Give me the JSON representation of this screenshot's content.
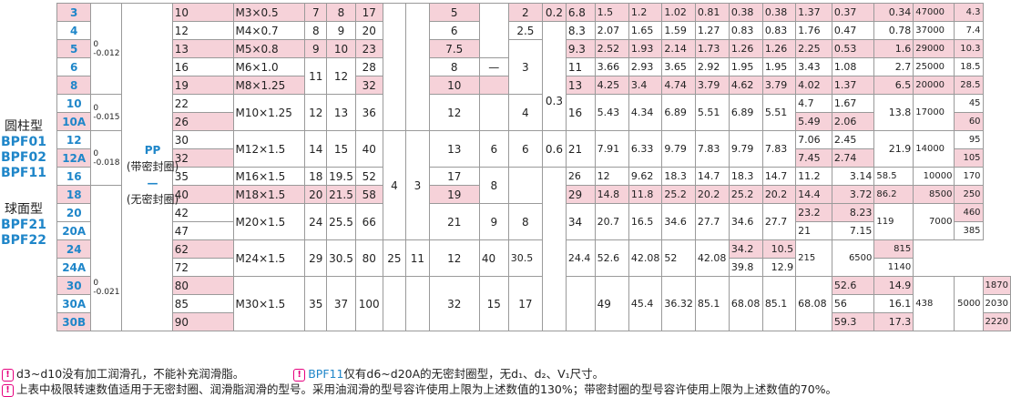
{
  "side_groups": [
    {
      "label": "圆柱型",
      "codes": [
        "BPF01",
        "BPF02",
        "BPF11"
      ]
    },
    {
      "label": "球面型",
      "codes": [
        "BPF21",
        "BPF22"
      ]
    }
  ],
  "tolerances": {
    "t1": {
      "upper": "0",
      "lower": "-0.012"
    },
    "t2": {
      "upper": "0",
      "lower": "-0.015"
    },
    "t3": {
      "upper": "0",
      "lower": "-0.018"
    },
    "t4": {
      "upper": "0",
      "lower": "-0.021"
    }
  },
  "seal": {
    "pp": "PP",
    "pp_note": "(带密封圈)",
    "dash": "—",
    "dash_note": "(无密封圈)"
  },
  "rows": [
    {
      "type": "3",
      "L": "10",
      "M": "M3×0.5",
      "a": "7",
      "b": "8",
      "c": "17",
      "h": "5",
      "j": "2",
      "k": "0.2",
      "d1": "6.8",
      "v1": "1.5",
      "v2": "1.2",
      "v3": "1.02",
      "v4": "0.81",
      "v5": "0.38",
      "v6": "0.38",
      "w1": "1.37",
      "w2": "0.37",
      "w3": "0.34",
      "rpm": "47000",
      "mass": "4.3"
    },
    {
      "type": "4",
      "L": "12",
      "M": "M4×0.7",
      "a": "8",
      "b": "9",
      "c": "20",
      "h": "6",
      "j": "2.5",
      "d1": "8.3",
      "v1": "2.07",
      "v2": "1.65",
      "v3": "1.59",
      "v4": "1.27",
      "v5": "0.83",
      "v6": "0.83",
      "w1": "1.76",
      "w2": "0.47",
      "w3": "0.78",
      "rpm": "37000",
      "mass": "7.4"
    },
    {
      "type": "5",
      "L": "13",
      "M": "M5×0.8",
      "a": "9",
      "b": "10",
      "c": "23",
      "h": "7.5",
      "j": "3",
      "d1": "9.3",
      "v1": "2.52",
      "v2": "1.93",
      "v3": "2.14",
      "v4": "1.73",
      "v5": "1.26",
      "v6": "1.26",
      "w1": "2.25",
      "w2": "0.53",
      "w3": "1.6",
      "rpm": "29000",
      "mass": "10.3"
    },
    {
      "type": "6",
      "L": "16",
      "M": "M6×1.0",
      "ab": "11",
      "bb": "12",
      "c": "28",
      "dash": "—",
      "h": "8",
      "d1": "11",
      "v1": "3.66",
      "v2": "2.93",
      "v3": "3.65",
      "v4": "2.92",
      "v5": "1.95",
      "v6": "1.95",
      "w1": "3.43",
      "w2": "1.08",
      "w3": "2.7",
      "rpm": "25000",
      "mass": "18.5"
    },
    {
      "type": "8",
      "L": "19",
      "M": "M8×1.25",
      "c": "32",
      "h": "10",
      "k": "0.3",
      "d1": "13",
      "v1": "4.25",
      "v2": "3.4",
      "v3": "4.74",
      "v4": "3.79",
      "v5": "4.62",
      "v6": "3.79",
      "w1": "4.02",
      "w2": "1.37",
      "w3": "6.5",
      "rpm": "20000",
      "mass": "28.5"
    },
    {
      "type": "10",
      "L": "22",
      "M": "M10×1.25",
      "a": "12",
      "b": "13",
      "c": "36",
      "h": "12",
      "j": "4",
      "d1": "16",
      "v1": "5.43",
      "v2": "4.34",
      "v3": "6.89",
      "v4": "5.51",
      "v5": "6.89",
      "v6": "5.51",
      "w1": "4.7",
      "w2": "1.67",
      "w3": "13.8",
      "rpm": "17000",
      "mass": "45"
    },
    {
      "type": "10A",
      "L": "26",
      "w1": "5.49",
      "w2": "2.06",
      "mass": "60"
    },
    {
      "type": "12",
      "L": "30",
      "M": "M12×1.5",
      "a": "14",
      "b": "15",
      "c": "40",
      "g": "4",
      "g2": "3",
      "h": "13",
      "i": "6",
      "j": "6",
      "k": "0.6",
      "d1": "21",
      "v1": "7.91",
      "v2": "6.33",
      "v3": "9.79",
      "v4": "7.83",
      "v5": "9.79",
      "v6": "7.83",
      "w1": "7.06",
      "w2": "2.45",
      "w3": "21.9",
      "rpm": "14000",
      "mass": "95"
    },
    {
      "type": "12A",
      "L": "32",
      "w1": "7.45",
      "w2": "2.74",
      "mass": "105"
    },
    {
      "type": "16",
      "L": "35",
      "M": "M16×1.5",
      "a": "18",
      "b": "19.5",
      "c": "52",
      "h": "17",
      "i": "8",
      "d1": "26",
      "v1": "12",
      "v2": "9.62",
      "v3": "18.3",
      "v4": "14.7",
      "v5": "18.3",
      "v6": "14.7",
      "w1": "11.2",
      "w2": "3.14",
      "w3": "58.5",
      "rpm": "10000",
      "mass": "170"
    },
    {
      "type": "18",
      "L": "40",
      "M": "M18×1.5",
      "a": "20",
      "b": "21.5",
      "c": "58",
      "h": "19",
      "d1": "29",
      "v1": "14.8",
      "v2": "11.8",
      "v3": "25.2",
      "v4": "20.2",
      "v5": "25.2",
      "v6": "20.2",
      "w1": "14.4",
      "w2": "3.72",
      "w3": "86.2",
      "rpm": "8500",
      "mass": "250"
    },
    {
      "type": "20",
      "L": "42",
      "M": "M20×1.5",
      "a": "24",
      "b": "25.5",
      "c": "66",
      "h": "21",
      "i": "9",
      "j": "8",
      "d1": "34",
      "v1": "20.7",
      "v2": "16.5",
      "v3": "34.6",
      "v4": "27.7",
      "v5": "34.6",
      "v6": "27.7",
      "w1": "23.2",
      "w2": "8.23",
      "w3": "119",
      "rpm": "7000",
      "mass": "460"
    },
    {
      "type": "20A",
      "L": "47",
      "w1": "21",
      "w2": "7.15",
      "mass": "385"
    },
    {
      "type": "24",
      "L": "62",
      "M": "M24×1.5",
      "a": "29",
      "b": "30.5",
      "c": "80",
      "g": "6",
      "g2": "4",
      "h": "25",
      "i": "11",
      "j": "12",
      "k": "1",
      "d1": "40",
      "v1": "30.5",
      "v2": "24.4",
      "v3": "52.6",
      "v4": "42.08",
      "v5": "52",
      "v6": "42.08",
      "w1": "34.2",
      "w2": "10.5",
      "w3": "215",
      "rpm": "6500",
      "mass": "815"
    },
    {
      "type": "24A",
      "L": "72",
      "w1": "39.8",
      "w2": "12.9",
      "mass": "1140"
    },
    {
      "type": "30",
      "L": "80",
      "w1": "52.6",
      "w2": "14.9",
      "mass": "1870"
    },
    {
      "type": "30A",
      "L": "85",
      "M": "M30×1.5",
      "a": "35",
      "b": "37",
      "c": "100",
      "h": "32",
      "i": "15",
      "j": "17",
      "d1": "49",
      "v1": "45.4",
      "v2": "36.32",
      "v3": "85.1",
      "v4": "68.08",
      "v5": "85.1",
      "v6": "68.08",
      "w1": "56",
      "w2": "16.1",
      "w3": "438",
      "rpm": "5000",
      "mass": "2030"
    },
    {
      "type": "30B",
      "L": "90",
      "w1": "59.3",
      "w2": "17.3",
      "mass": "2220"
    }
  ],
  "notes": {
    "n1": "d3~d10没有加工润滑孔，不能补充润滑脂。",
    "n2_code": "BPF11",
    "n2": "仅有d6~d20A的无密封圈型，无d₁、d₂、V₁尺寸。",
    "n3": "上表中极限转速数值适用于无密封圈、润滑脂润滑的型号。采用油润滑的型号容许使用上限为上述数值的130%；带密封圈的型号容许使用上限为上述数值的70%。"
  }
}
